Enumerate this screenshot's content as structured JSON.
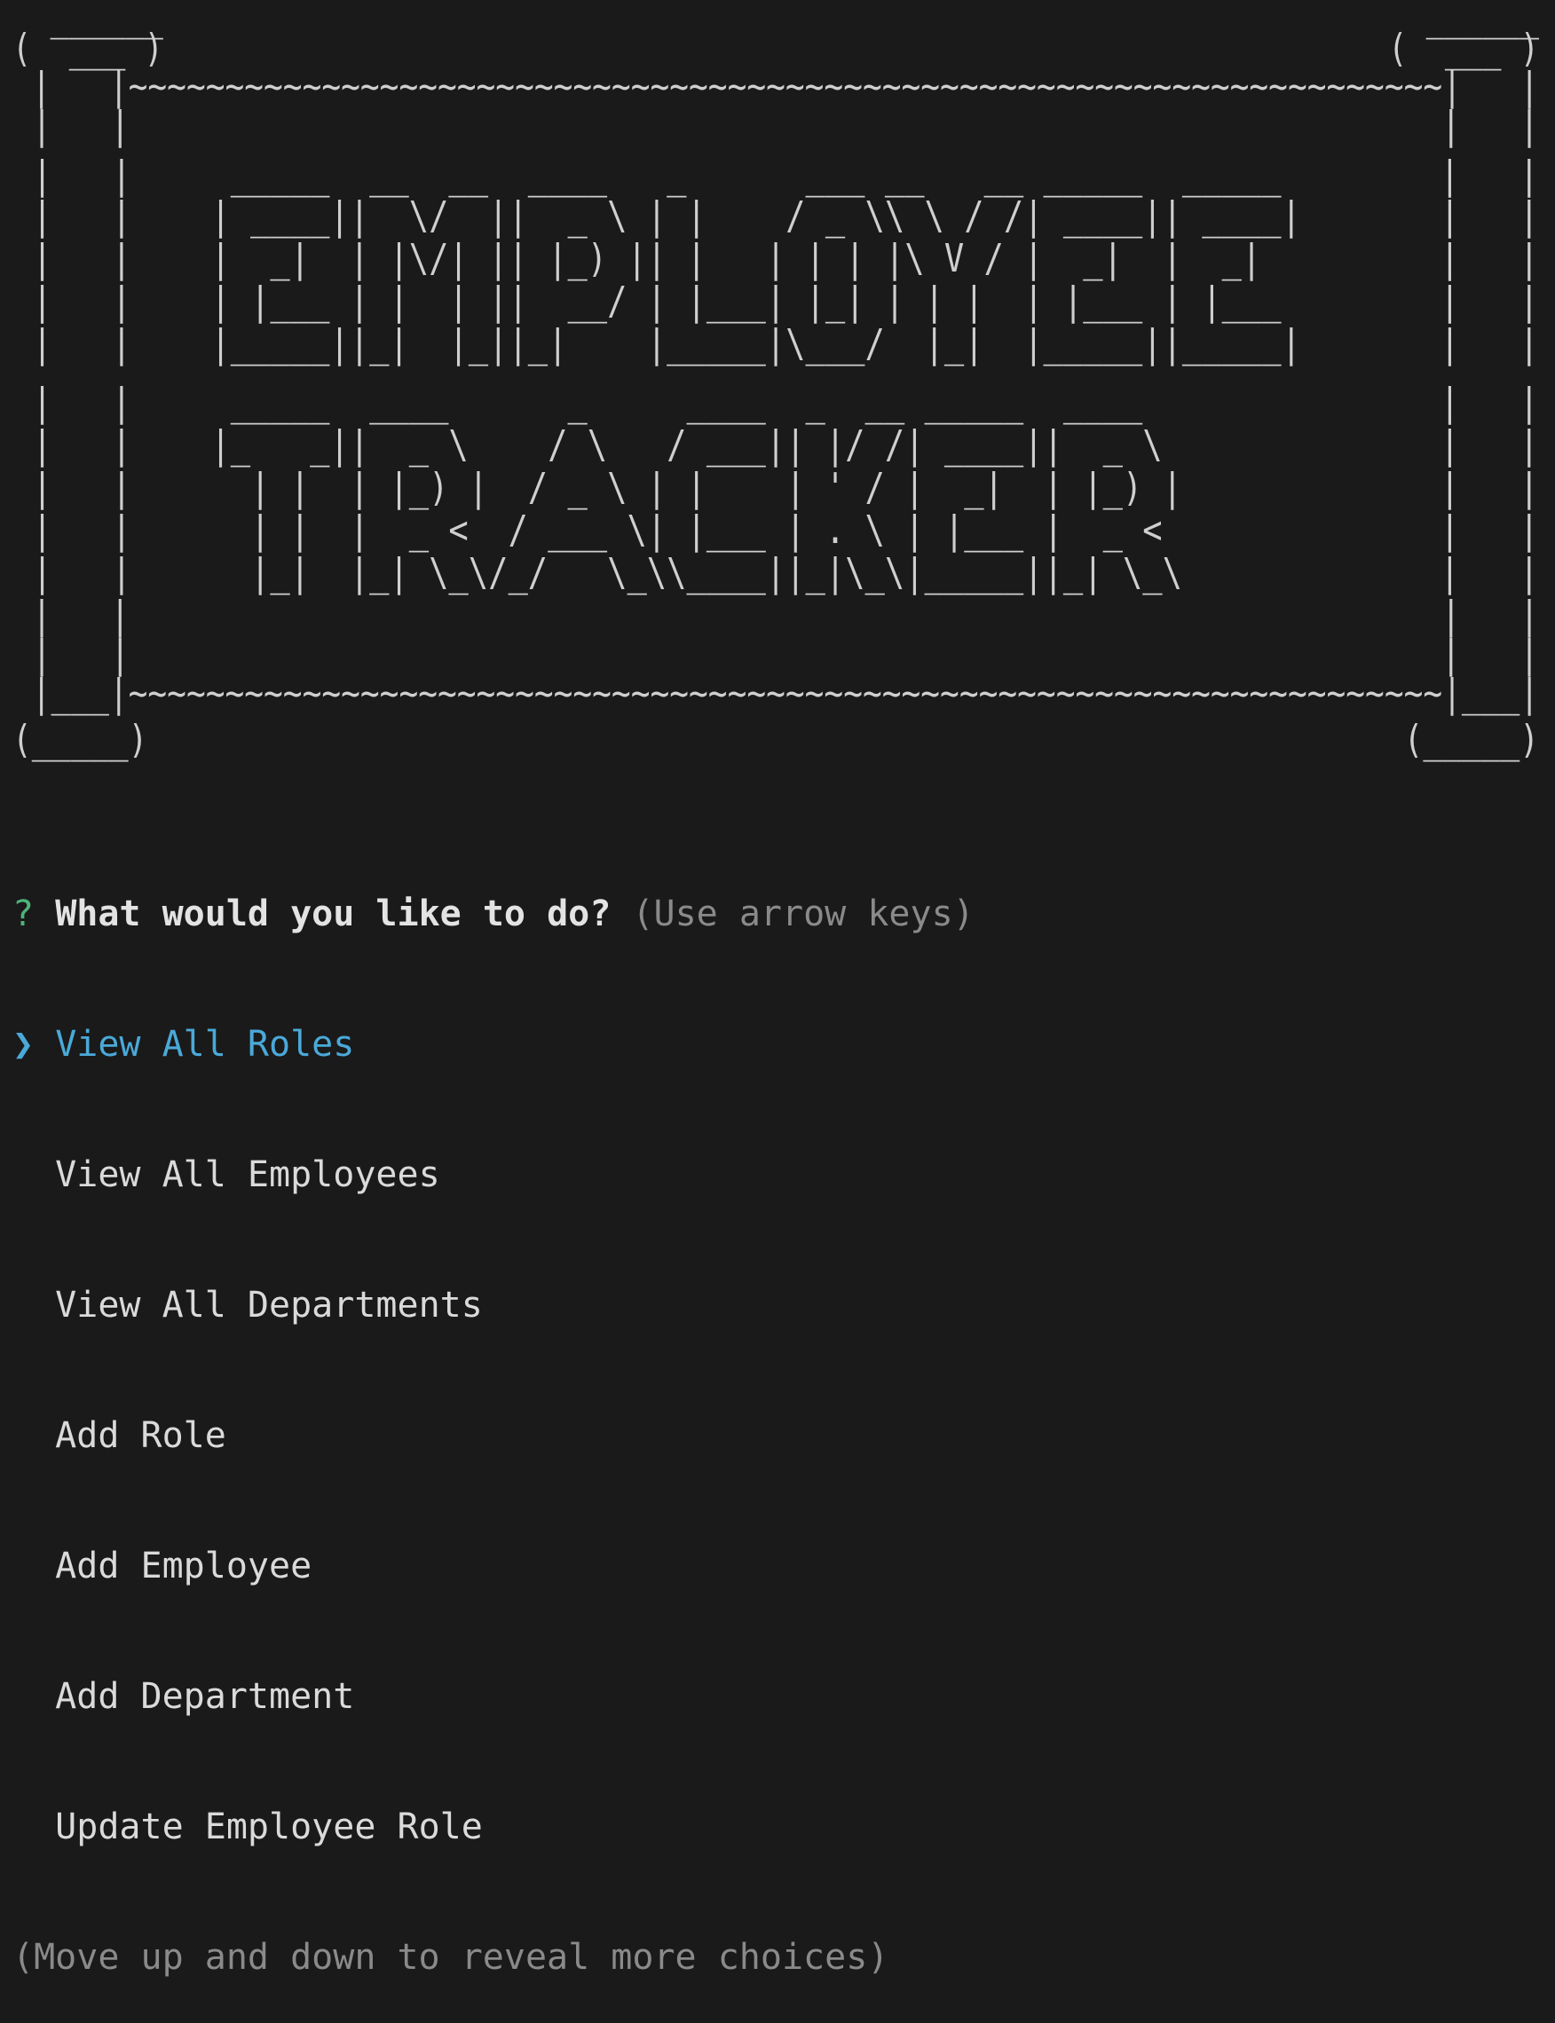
{
  "banner": {
    "lines": [
      "  ______                                                                   ______",
      "(  ___ )                                                                 (  ___ )",
      " |   |~~~~~~~~~~~~~~~~~~~~~~~~~~~~~~~~~~~~~~~~~~~~~~~~~~~~~~~~~~~~~~~~~~~~|   |",
      " |   |                                                                   |   |",
      " |   |     _____  __  __  ____   _      ___ __   __ _____  _____        |   |",
      " |   |    | ____||  \\/  ||  _ \\ | |    / _ \\\\ \\ / /| ____|| ____|       |   |",
      " |   |    |  _|  | |\\/| || |_) || |   | | | |\\ V / |  _|  |  _|         |   |",
      " |   |    | |___ | |  | ||  __/ | |___| |_| | | |  | |___ | |___        |   |",
      " |   |    |_____||_|  |_||_|    |_____|\\___/  |_|  |_____||_____|       |   |",
      " |   |     _____  ____      _     ____  _  __ _____  ____               |   |",
      " |   |    |_   _||  _ \\    / \\   / ___|| |/ /| ____||  _ \\              |   |",
      " |   |      | |  | |_) |  / _ \\ | |    | ' / |  _|  | |_) |             |   |",
      " |   |      | |  |  _ <  / ___ \\| |___ | . \\ | |___ |  _ <              |   |",
      " |   |      |_|  |_| \\_\\/_/   \\_\\\\____||_|\\_\\|_____||_| \\_\\             |   |",
      " |   |                                                                   |   |",
      " |   |                                                                   |   |",
      " |___|~~~~~~~~~~~~~~~~~~~~~~~~~~~~~~~~~~~~~~~~~~~~~~~~~~~~~~~~~~~~~~~~~~~~|___|",
      "(_____)                                                                 (_____)"
    ]
  },
  "prompt": {
    "qmark": "?",
    "question": "What would you like to do?",
    "hint": "(Use arrow keys)",
    "pointer": "❯",
    "choices": [
      "View All Roles",
      "View All Employees",
      "View All Departments",
      "Add Role",
      "Add Employee",
      "Add Department",
      "Update Employee Role"
    ],
    "footer": "(Move up and down to reveal more choices)"
  },
  "colors": {
    "background": "#1a1a1a",
    "text": "#d2d2d2",
    "qmark": "#4fb37a",
    "selected": "#4aa9d9",
    "muted": "#8a8a8a"
  }
}
